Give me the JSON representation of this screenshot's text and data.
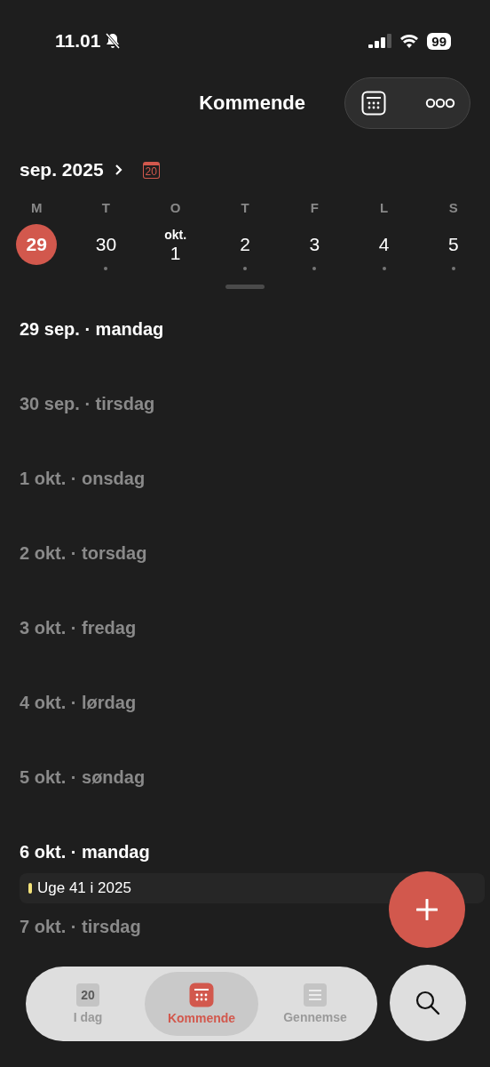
{
  "status_bar": {
    "time": "11.01",
    "battery": "99"
  },
  "header": {
    "title": "Kommende"
  },
  "month": {
    "label": "sep. 2025",
    "today_badge": "20"
  },
  "week": {
    "weekdays": [
      "M",
      "T",
      "O",
      "T",
      "F",
      "L",
      "S"
    ],
    "days": [
      {
        "number": "29",
        "selected": true,
        "dot": false
      },
      {
        "number": "30",
        "selected": false,
        "dot": true
      },
      {
        "month": "okt.",
        "number": "1",
        "selected": false,
        "dot": false
      },
      {
        "number": "2",
        "selected": false,
        "dot": true
      },
      {
        "number": "3",
        "selected": false,
        "dot": true
      },
      {
        "number": "4",
        "selected": false,
        "dot": true
      },
      {
        "number": "5",
        "selected": false,
        "dot": true
      }
    ]
  },
  "sections": [
    {
      "heading": "29 sep. · mandag",
      "dimmed": false
    },
    {
      "heading": "30 sep. · tirsdag",
      "dimmed": true
    },
    {
      "heading": "1 okt. · onsdag",
      "dimmed": true
    },
    {
      "heading": "2 okt. · torsdag",
      "dimmed": true
    },
    {
      "heading": "3 okt. · fredag",
      "dimmed": true
    },
    {
      "heading": "4 okt. · lørdag",
      "dimmed": true
    },
    {
      "heading": "5 okt. · søndag",
      "dimmed": true
    },
    {
      "heading": "6 okt. · mandag",
      "dimmed": false,
      "week_chip": {
        "label": "Uge 41 i 2025",
        "color": "#f3e27a"
      }
    },
    {
      "heading": "7 okt. · tirsdag",
      "dimmed": true
    }
  ],
  "tab_bar": {
    "tabs": [
      {
        "label": "I dag",
        "kind": "today",
        "badge": "20",
        "selected": false
      },
      {
        "label": "Kommende",
        "kind": "upcoming",
        "selected": true
      },
      {
        "label": "Gennemse",
        "kind": "browse",
        "selected": false
      }
    ]
  }
}
